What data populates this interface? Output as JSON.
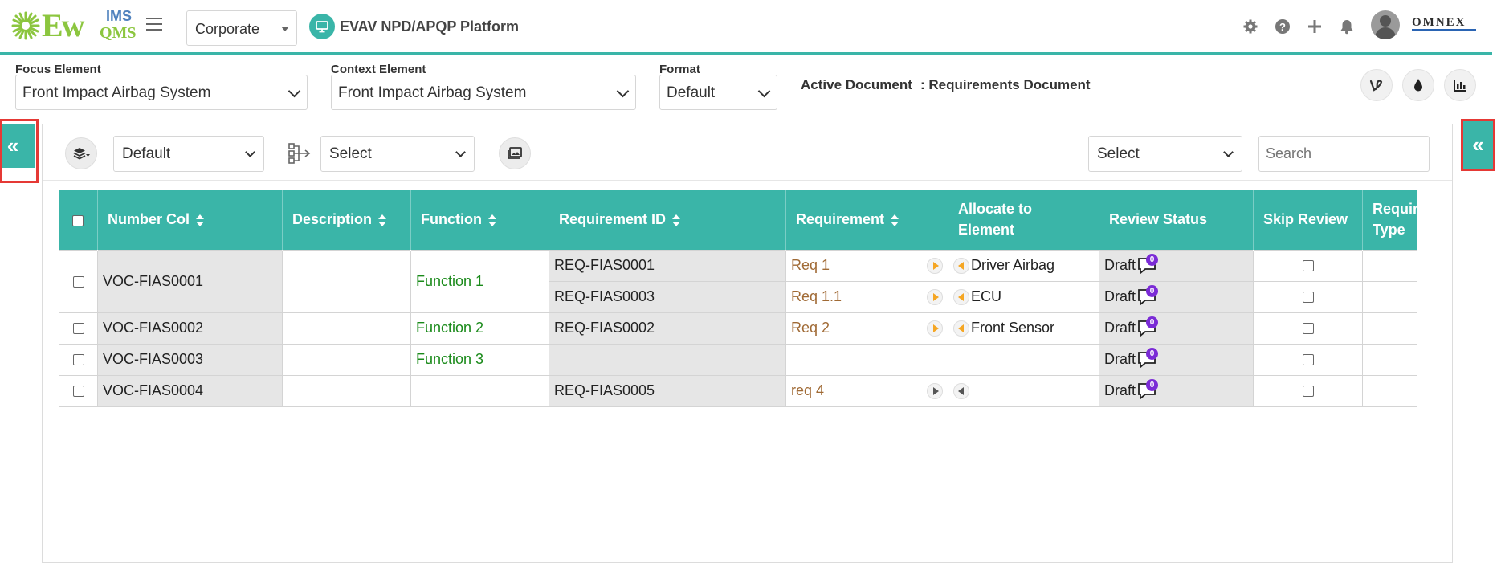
{
  "header": {
    "logo": {
      "ew": "Ew",
      "ims": "IMS",
      "qms": "QMS"
    },
    "org_select": "Corporate",
    "platform_title": "EVAV NPD/APQP Platform",
    "omnex_logo": "OMNEX",
    "icons": [
      "gear-icon",
      "help-icon",
      "plus-icon",
      "bell-icon"
    ]
  },
  "selectors": {
    "focus_label": "Focus Element",
    "focus_value": "Front Impact Airbag System",
    "context_label": "Context Element",
    "context_value": "Front Impact Airbag System",
    "format_label": "Format",
    "format_value": "Default",
    "active_doc_label": "Active Document",
    "active_doc_value": ": Requirements Document"
  },
  "side": {
    "left_toggle": "«",
    "right_toggle": "«"
  },
  "toolbar": {
    "view_select": "Default",
    "hier_select": "Select",
    "filter_select": "Select",
    "search_placeholder": "Search"
  },
  "table": {
    "headers": {
      "number": "Number Col",
      "description": "Description",
      "function": "Function",
      "req_id": "Requirement ID",
      "requirement": "Requirement",
      "allocate": "Allocate to Element",
      "review": "Review Status",
      "skip": "Skip Review",
      "req_type": "Requirement Type"
    },
    "rows": [
      {
        "number": "VOC-FIAS0001",
        "function": "Function 1",
        "sub": [
          {
            "req_id": "REQ-FIAS0001",
            "requirement": "Req 1",
            "allocate": "Driver Airbag",
            "review": "Draft",
            "comments": "0"
          },
          {
            "req_id": "REQ-FIAS0003",
            "requirement": "Req 1.1",
            "allocate": "ECU",
            "review": "Draft",
            "comments": "0"
          }
        ]
      },
      {
        "number": "VOC-FIAS0002",
        "function": "Function 2",
        "req_id": "REQ-FIAS0002",
        "requirement": "Req 2",
        "allocate": "Front Sensor",
        "review": "Draft",
        "comments": "0"
      },
      {
        "number": "VOC-FIAS0003",
        "function": "Function 3",
        "req_id": "",
        "requirement": "",
        "allocate": "",
        "review": "Draft",
        "comments": "0"
      },
      {
        "number": "VOC-FIAS0004",
        "function": "",
        "req_id": "REQ-FIAS0005",
        "requirement": "req 4",
        "allocate": "",
        "review": "Draft",
        "comments": "0"
      }
    ]
  },
  "colors": {
    "accent": "#3ab5a8",
    "badge": "#7b2bd6",
    "function_text": "#1a8a1a",
    "requirement_text": "#a06a35",
    "highlight_border": "#e53935"
  }
}
